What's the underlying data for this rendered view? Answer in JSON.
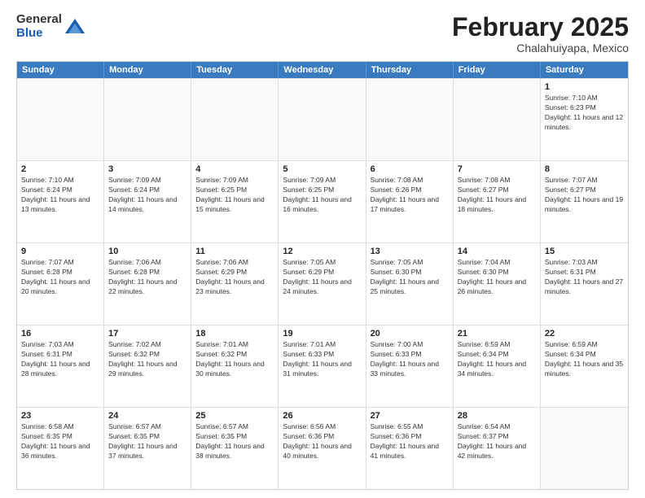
{
  "header": {
    "logo_general": "General",
    "logo_blue": "Blue",
    "title": "February 2025",
    "subtitle": "Chalahuiyapa, Mexico"
  },
  "days_of_week": [
    "Sunday",
    "Monday",
    "Tuesday",
    "Wednesday",
    "Thursday",
    "Friday",
    "Saturday"
  ],
  "weeks": [
    [
      {
        "day": "",
        "info": ""
      },
      {
        "day": "",
        "info": ""
      },
      {
        "day": "",
        "info": ""
      },
      {
        "day": "",
        "info": ""
      },
      {
        "day": "",
        "info": ""
      },
      {
        "day": "",
        "info": ""
      },
      {
        "day": "1",
        "info": "Sunrise: 7:10 AM\nSunset: 6:23 PM\nDaylight: 11 hours and 12 minutes."
      }
    ],
    [
      {
        "day": "2",
        "info": "Sunrise: 7:10 AM\nSunset: 6:24 PM\nDaylight: 11 hours and 13 minutes."
      },
      {
        "day": "3",
        "info": "Sunrise: 7:09 AM\nSunset: 6:24 PM\nDaylight: 11 hours and 14 minutes."
      },
      {
        "day": "4",
        "info": "Sunrise: 7:09 AM\nSunset: 6:25 PM\nDaylight: 11 hours and 15 minutes."
      },
      {
        "day": "5",
        "info": "Sunrise: 7:09 AM\nSunset: 6:25 PM\nDaylight: 11 hours and 16 minutes."
      },
      {
        "day": "6",
        "info": "Sunrise: 7:08 AM\nSunset: 6:26 PM\nDaylight: 11 hours and 17 minutes."
      },
      {
        "day": "7",
        "info": "Sunrise: 7:08 AM\nSunset: 6:27 PM\nDaylight: 11 hours and 18 minutes."
      },
      {
        "day": "8",
        "info": "Sunrise: 7:07 AM\nSunset: 6:27 PM\nDaylight: 11 hours and 19 minutes."
      }
    ],
    [
      {
        "day": "9",
        "info": "Sunrise: 7:07 AM\nSunset: 6:28 PM\nDaylight: 11 hours and 20 minutes."
      },
      {
        "day": "10",
        "info": "Sunrise: 7:06 AM\nSunset: 6:28 PM\nDaylight: 11 hours and 22 minutes."
      },
      {
        "day": "11",
        "info": "Sunrise: 7:06 AM\nSunset: 6:29 PM\nDaylight: 11 hours and 23 minutes."
      },
      {
        "day": "12",
        "info": "Sunrise: 7:05 AM\nSunset: 6:29 PM\nDaylight: 11 hours and 24 minutes."
      },
      {
        "day": "13",
        "info": "Sunrise: 7:05 AM\nSunset: 6:30 PM\nDaylight: 11 hours and 25 minutes."
      },
      {
        "day": "14",
        "info": "Sunrise: 7:04 AM\nSunset: 6:30 PM\nDaylight: 11 hours and 26 minutes."
      },
      {
        "day": "15",
        "info": "Sunrise: 7:03 AM\nSunset: 6:31 PM\nDaylight: 11 hours and 27 minutes."
      }
    ],
    [
      {
        "day": "16",
        "info": "Sunrise: 7:03 AM\nSunset: 6:31 PM\nDaylight: 11 hours and 28 minutes."
      },
      {
        "day": "17",
        "info": "Sunrise: 7:02 AM\nSunset: 6:32 PM\nDaylight: 11 hours and 29 minutes."
      },
      {
        "day": "18",
        "info": "Sunrise: 7:01 AM\nSunset: 6:32 PM\nDaylight: 11 hours and 30 minutes."
      },
      {
        "day": "19",
        "info": "Sunrise: 7:01 AM\nSunset: 6:33 PM\nDaylight: 11 hours and 31 minutes."
      },
      {
        "day": "20",
        "info": "Sunrise: 7:00 AM\nSunset: 6:33 PM\nDaylight: 11 hours and 33 minutes."
      },
      {
        "day": "21",
        "info": "Sunrise: 6:59 AM\nSunset: 6:34 PM\nDaylight: 11 hours and 34 minutes."
      },
      {
        "day": "22",
        "info": "Sunrise: 6:59 AM\nSunset: 6:34 PM\nDaylight: 11 hours and 35 minutes."
      }
    ],
    [
      {
        "day": "23",
        "info": "Sunrise: 6:58 AM\nSunset: 6:35 PM\nDaylight: 11 hours and 36 minutes."
      },
      {
        "day": "24",
        "info": "Sunrise: 6:57 AM\nSunset: 6:35 PM\nDaylight: 11 hours and 37 minutes."
      },
      {
        "day": "25",
        "info": "Sunrise: 6:57 AM\nSunset: 6:35 PM\nDaylight: 11 hours and 38 minutes."
      },
      {
        "day": "26",
        "info": "Sunrise: 6:56 AM\nSunset: 6:36 PM\nDaylight: 11 hours and 40 minutes."
      },
      {
        "day": "27",
        "info": "Sunrise: 6:55 AM\nSunset: 6:36 PM\nDaylight: 11 hours and 41 minutes."
      },
      {
        "day": "28",
        "info": "Sunrise: 6:54 AM\nSunset: 6:37 PM\nDaylight: 11 hours and 42 minutes."
      },
      {
        "day": "",
        "info": ""
      }
    ]
  ]
}
